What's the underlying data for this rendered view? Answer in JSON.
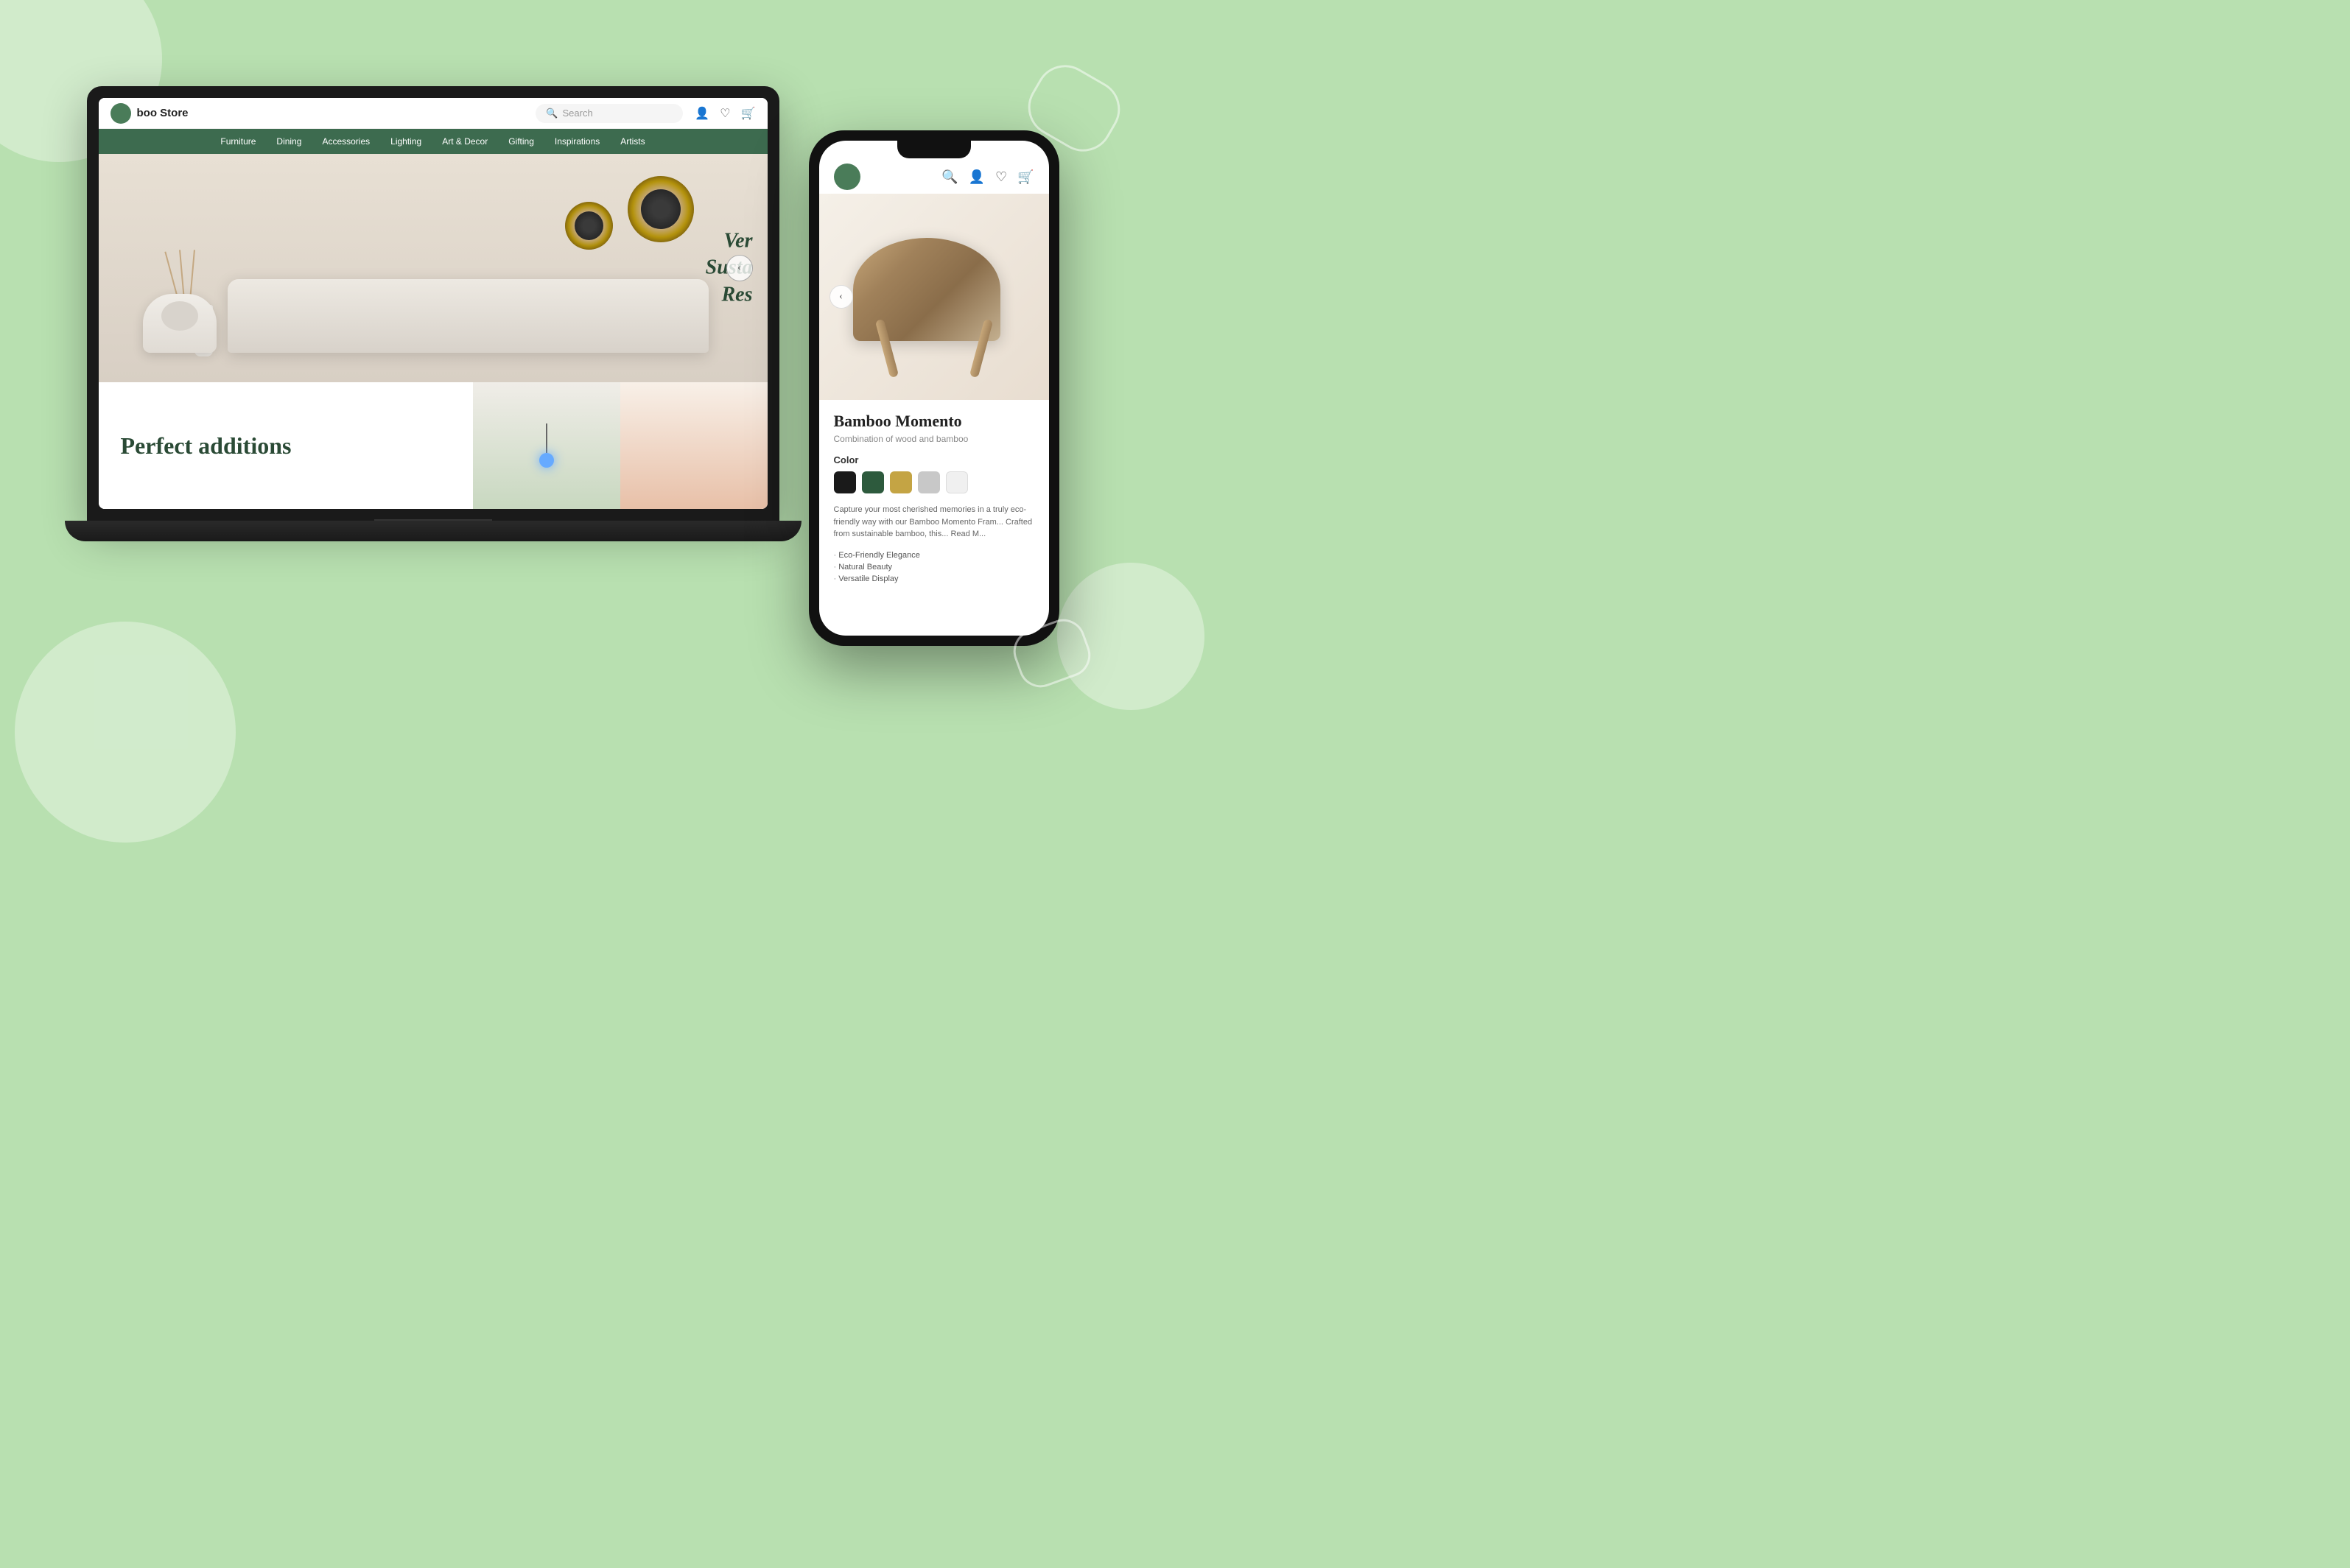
{
  "background": {
    "color": "#b8e0b0"
  },
  "laptop": {
    "browser": {
      "logo_text": "boo Store",
      "search_placeholder": "Search",
      "nav_items": [
        "Furniture",
        "Dining",
        "Accessories",
        "Lighting",
        "Art & Decor",
        "Gifting",
        "Inspirations",
        "Artists"
      ],
      "hero_text_line1": "Ver",
      "hero_text_line2": "Susta",
      "hero_text_line3": "Res",
      "bottom_text": "Perfect additions"
    }
  },
  "phone": {
    "product": {
      "name": "Bamboo Momento",
      "subtitle": "Combination of wood and bamboo",
      "color_label": "Color",
      "description": "Capture your most cherished memories in a truly eco-friendly way with our Bamboo Momento Fram... Crafted from sustainable bamboo, this... Read M...",
      "features": [
        "Eco-Friendly Elegance",
        "Natural Beauty",
        "Versatile Display"
      ],
      "swatches": [
        "black",
        "green",
        "gold",
        "gray",
        "white"
      ]
    }
  },
  "icons": {
    "search": "🔍",
    "user": "👤",
    "wishlist": "♡",
    "cart": "🛒",
    "back_arrow": "‹"
  }
}
